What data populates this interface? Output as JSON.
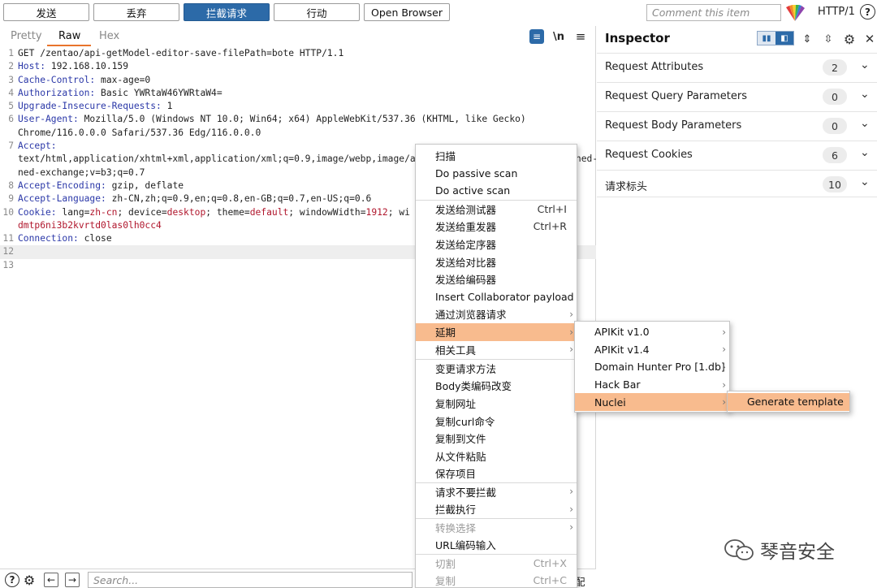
{
  "toolbar": {
    "buttons": [
      "发送",
      "丢弃",
      "拦截请求",
      "行动",
      "Open Browser"
    ],
    "comment_placeholder": "Comment this item",
    "protocol": "HTTP/1",
    "help": "?"
  },
  "editor": {
    "tabs": [
      "Pretty",
      "Raw",
      "Hex"
    ],
    "newline_icon": "\\n",
    "lines": [
      {
        "n": "1",
        "text": "GET /zentao/api-getModel-editor-save-filePath=bote HTTP/1.1"
      },
      {
        "n": "2",
        "key": "Host:",
        "text": " 192.168.10.159"
      },
      {
        "n": "3",
        "key": "Cache-Control:",
        "text": " max-age=0"
      },
      {
        "n": "4",
        "key": "Authorization:",
        "text": " Basic YWRtaW46YWRtaW4="
      },
      {
        "n": "5",
        "key": "Upgrade-Insecure-Requests:",
        "text": " 1"
      },
      {
        "n": "6",
        "key": "User-Agent:",
        "text": " Mozilla/5.0 (Windows NT 10.0; Win64; x64) AppleWebKit/537.36 (KHTML, like Gecko)"
      },
      {
        "n": "",
        "text": "Chrome/116.0.0.0 Safari/537.36 Edg/116.0.0.0"
      },
      {
        "n": "7",
        "key": "Accept:",
        "text": ""
      },
      {
        "n": "",
        "text": "text/html,application/xhtml+xml,application/xml;q=0.9,image/webp,image/apng,*/*;q=0.8,application/signed-exchange;v=b3;q=0.7"
      },
      {
        "n": "",
        "text": "ned-exchange;v=b3;q=0.7"
      },
      {
        "n": "8",
        "key": "Accept-Encoding:",
        "text": " gzip, deflate"
      },
      {
        "n": "9",
        "key": "Accept-Language:",
        "text": " zh-CN,zh;q=0.9,en;q=0.8,en-GB;q=0.7,en-US;q=0.6"
      },
      {
        "n": "10",
        "key": "Cookie:",
        "text": ""
      },
      {
        "n": "",
        "text": "dmtp6ni3b2kvrtd0las0lh0cc4"
      },
      {
        "n": "11",
        "key": "Connection:",
        "text": " close"
      },
      {
        "n": "12",
        "text": ""
      },
      {
        "n": "13",
        "text": ""
      }
    ],
    "cookie_parts": [
      " lang=",
      "zh-cn",
      "; device=",
      "desktop",
      "; theme=",
      "default",
      "; windowWidth=",
      "1912",
      "; wi"
    ]
  },
  "bottom": {
    "search_placeholder": "Search...",
    "tail_text": "配"
  },
  "inspector": {
    "title": "Inspector",
    "sections": [
      {
        "label": "Request Attributes",
        "count": "2"
      },
      {
        "label": "Request Query Parameters",
        "count": "0"
      },
      {
        "label": "Request Body Parameters",
        "count": "0"
      },
      {
        "label": "Request Cookies",
        "count": "6"
      },
      {
        "label": "请求标头",
        "count": "10"
      }
    ]
  },
  "context_menu": {
    "items": [
      {
        "label": "扫描"
      },
      {
        "label": "Do passive scan"
      },
      {
        "label": "Do active scan"
      },
      {
        "label": "发送给测试器",
        "shortcut": "Ctrl+I"
      },
      {
        "label": "发送给重发器",
        "shortcut": "Ctrl+R"
      },
      {
        "label": "发送给定序器"
      },
      {
        "label": "发送给对比器"
      },
      {
        "label": "发送给编码器"
      },
      {
        "label": "Insert Collaborator payload"
      },
      {
        "label": "通过浏览器请求",
        "arrow": "›"
      },
      {
        "label": "延期",
        "arrow": "›"
      },
      {
        "label": "相关工具",
        "arrow": "›"
      },
      {
        "label": "变更请求方法"
      },
      {
        "label": "Body类编码改变"
      },
      {
        "label": "复制网址"
      },
      {
        "label": "复制curl命令"
      },
      {
        "label": "复制到文件"
      },
      {
        "label": "从文件粘贴"
      },
      {
        "label": "保存项目"
      },
      {
        "label": "请求不要拦截",
        "arrow": "›"
      },
      {
        "label": "拦截执行",
        "arrow": "›"
      },
      {
        "label": "转换选择",
        "arrow": "›"
      },
      {
        "label": "URL编码输入"
      },
      {
        "label": "切割",
        "shortcut": "Ctrl+X"
      },
      {
        "label": "复制",
        "shortcut": "Ctrl+C"
      }
    ]
  },
  "submenu": {
    "items": [
      {
        "label": "APIKit v1.0",
        "arrow": "›"
      },
      {
        "label": "APIKit v1.4",
        "arrow": "›"
      },
      {
        "label": "Domain Hunter Pro [1.db]",
        "arrow": "›"
      },
      {
        "label": "Hack Bar",
        "arrow": "›"
      },
      {
        "label": "Nuclei",
        "arrow": "›"
      }
    ]
  },
  "submenu2": {
    "items": [
      {
        "label": "Generate template"
      }
    ]
  },
  "watermark": {
    "text": "琴音安全"
  },
  "colors": {
    "accent": "#2c6aa8",
    "highlight": "#f8bb8e",
    "tab_underline": "#e8742c"
  }
}
